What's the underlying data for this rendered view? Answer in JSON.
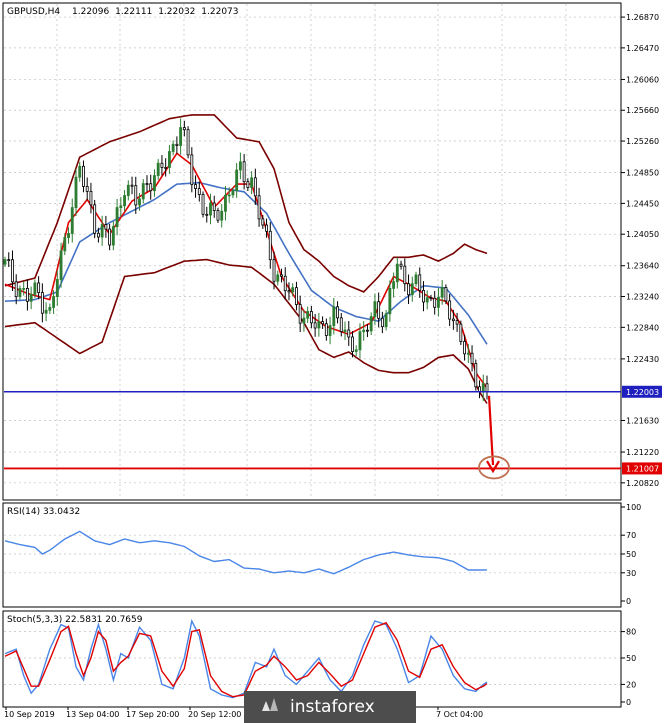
{
  "colors": {
    "background": "#ffffff",
    "grid": "#c0c0c0",
    "frame": "#000000",
    "bull_candle": "#2e7d32",
    "bear_candle": "#000000",
    "bollinger": "#7a0000",
    "ma_fast": "#e00000",
    "ma_slow": "#4472c4",
    "rsi_line": "#4a86e8",
    "stoch_main": "#4a86e8",
    "stoch_signal": "#e00000",
    "current_price_line": "#1f1fbf",
    "target_line": "#e00000",
    "target_label_bg": "#e00000",
    "current_label_bg": "#1f1fbf",
    "forecast_arrow": "#e00000",
    "watermark_bg": "#4d4d4d"
  },
  "chart_data": [
    {
      "type": "candlestick",
      "title": "GBPUSD,H4",
      "ohlc_header": [
        "1.22096",
        "1.22111",
        "1.22032",
        "1.22073"
      ],
      "ylim": [
        1.2061,
        1.2704
      ],
      "y_ticks": [
        "1.26870",
        "1.26470",
        "1.26060",
        "1.25660",
        "1.25260",
        "1.24850",
        "1.24450",
        "1.24050",
        "1.23640",
        "1.23240",
        "1.22840",
        "1.22430",
        "1.21630",
        "1.21220",
        "1.20820"
      ],
      "x_ticks": [
        "10 Sep 2019",
        "13 Sep 04:00",
        "17 Sep 20:00",
        "20 Sep 12:00",
        "7 Oct 04:00"
      ],
      "current_price": 1.22003,
      "current_price_label": "1.22003",
      "target_price": 1.21007,
      "target_price_label": "1.21007",
      "forecast": {
        "from": 1.2195,
        "to": 1.2118,
        "marker": "circle"
      },
      "close_anchors": [
        [
          0,
          1.2365
        ],
        [
          3,
          1.234
        ],
        [
          6,
          1.2322
        ],
        [
          9,
          1.233
        ],
        [
          12,
          1.23
        ],
        [
          15,
          1.2372
        ],
        [
          18,
          1.2448
        ],
        [
          20,
          1.2488
        ],
        [
          24,
          1.242
        ],
        [
          28,
          1.2395
        ],
        [
          32,
          1.247
        ],
        [
          35,
          1.2445
        ],
        [
          38,
          1.2475
        ],
        [
          41,
          1.248
        ],
        [
          44,
          1.251
        ],
        [
          47,
          1.2545
        ],
        [
          50,
          1.248
        ],
        [
          53,
          1.244
        ],
        [
          56,
          1.2425
        ],
        [
          60,
          1.246
        ],
        [
          63,
          1.2485
        ],
        [
          66,
          1.2475
        ],
        [
          69,
          1.241
        ],
        [
          72,
          1.236
        ],
        [
          76,
          1.2328
        ],
        [
          80,
          1.23
        ],
        [
          84,
          1.228
        ],
        [
          88,
          1.23
        ],
        [
          92,
          1.2265
        ],
        [
          96,
          1.227
        ],
        [
          99,
          1.231
        ],
        [
          102,
          1.2295
        ],
        [
          105,
          1.237
        ],
        [
          107,
          1.2345
        ],
        [
          110,
          1.2335
        ],
        [
          113,
          1.232
        ],
        [
          116,
          1.2325
        ],
        [
          119,
          1.2305
        ],
        [
          122,
          1.2275
        ],
        [
          124,
          1.2235
        ],
        [
          127,
          1.2208
        ],
        [
          129,
          1.2205
        ]
      ],
      "bollinger_upper": [
        [
          0,
          1.2338
        ],
        [
          8,
          1.2348
        ],
        [
          14,
          1.242
        ],
        [
          20,
          1.2505
        ],
        [
          28,
          1.2525
        ],
        [
          36,
          1.2538
        ],
        [
          44,
          1.2555
        ],
        [
          50,
          1.256
        ],
        [
          56,
          1.256
        ],
        [
          62,
          1.253
        ],
        [
          68,
          1.2525
        ],
        [
          72,
          1.249
        ],
        [
          76,
          1.242
        ],
        [
          80,
          1.2385
        ],
        [
          84,
          1.237
        ],
        [
          88,
          1.235
        ],
        [
          92,
          1.2338
        ],
        [
          96,
          1.233
        ],
        [
          100,
          1.235
        ],
        [
          104,
          1.2375
        ],
        [
          108,
          1.2375
        ],
        [
          112,
          1.2378
        ],
        [
          116,
          1.237
        ],
        [
          120,
          1.238
        ],
        [
          123,
          1.2392
        ],
        [
          126,
          1.2385
        ],
        [
          129,
          1.238
        ]
      ],
      "bollinger_lower": [
        [
          0,
          1.2285
        ],
        [
          8,
          1.229
        ],
        [
          14,
          1.227
        ],
        [
          20,
          1.225
        ],
        [
          26,
          1.2265
        ],
        [
          32,
          1.235
        ],
        [
          40,
          1.2355
        ],
        [
          48,
          1.237
        ],
        [
          54,
          1.2372
        ],
        [
          60,
          1.2365
        ],
        [
          66,
          1.2362
        ],
        [
          72,
          1.234
        ],
        [
          76,
          1.2315
        ],
        [
          80,
          1.229
        ],
        [
          84,
          1.2255
        ],
        [
          88,
          1.2245
        ],
        [
          92,
          1.2252
        ],
        [
          96,
          1.2238
        ],
        [
          100,
          1.2228
        ],
        [
          104,
          1.2225
        ],
        [
          108,
          1.2225
        ],
        [
          112,
          1.2232
        ],
        [
          116,
          1.2245
        ],
        [
          120,
          1.2248
        ],
        [
          124,
          1.223
        ],
        [
          127,
          1.22
        ],
        [
          129,
          1.2185
        ]
      ],
      "ma_fast": [
        [
          0,
          1.234
        ],
        [
          6,
          1.2328
        ],
        [
          12,
          1.232
        ],
        [
          17,
          1.242
        ],
        [
          22,
          1.245
        ],
        [
          28,
          1.2405
        ],
        [
          34,
          1.2448
        ],
        [
          40,
          1.2465
        ],
        [
          46,
          1.251
        ],
        [
          50,
          1.2495
        ],
        [
          56,
          1.244
        ],
        [
          62,
          1.247
        ],
        [
          66,
          1.247
        ],
        [
          70,
          1.241
        ],
        [
          74,
          1.235
        ],
        [
          80,
          1.2305
        ],
        [
          86,
          1.2285
        ],
        [
          92,
          1.2275
        ],
        [
          98,
          1.229
        ],
        [
          104,
          1.235
        ],
        [
          108,
          1.234
        ],
        [
          114,
          1.2322
        ],
        [
          118,
          1.2318
        ],
        [
          122,
          1.2288
        ],
        [
          126,
          1.2225
        ],
        [
          129,
          1.2205
        ]
      ],
      "ma_slow": [
        [
          0,
          1.2318
        ],
        [
          8,
          1.232
        ],
        [
          14,
          1.233
        ],
        [
          20,
          1.2395
        ],
        [
          28,
          1.242
        ],
        [
          34,
          1.2435
        ],
        [
          40,
          1.245
        ],
        [
          46,
          1.247
        ],
        [
          52,
          1.2472
        ],
        [
          58,
          1.2465
        ],
        [
          64,
          1.246
        ],
        [
          70,
          1.2432
        ],
        [
          76,
          1.238
        ],
        [
          82,
          1.2332
        ],
        [
          88,
          1.231
        ],
        [
          94,
          1.2298
        ],
        [
          100,
          1.2292
        ],
        [
          106,
          1.2318
        ],
        [
          112,
          1.2338
        ],
        [
          118,
          1.2335
        ],
        [
          124,
          1.23
        ],
        [
          129,
          1.2262
        ]
      ]
    },
    {
      "type": "line",
      "title": "RSI(14) 33.0432",
      "ylim": [
        0,
        100
      ],
      "y_ticks": [
        "100",
        "70",
        "50",
        "30",
        "0"
      ],
      "levels": [
        70,
        50,
        30
      ],
      "series": [
        {
          "values": [
            [
              0,
              64
            ],
            [
              4,
              60
            ],
            [
              8,
              57
            ],
            [
              10,
              50
            ],
            [
              12,
              54
            ],
            [
              16,
              66
            ],
            [
              20,
              74
            ],
            [
              24,
              64
            ],
            [
              28,
              60
            ],
            [
              32,
              66
            ],
            [
              36,
              62
            ],
            [
              40,
              64
            ],
            [
              44,
              62
            ],
            [
              48,
              58
            ],
            [
              52,
              48
            ],
            [
              56,
              42
            ],
            [
              60,
              44
            ],
            [
              64,
              35
            ],
            [
              68,
              34
            ],
            [
              72,
              30
            ],
            [
              76,
              32
            ],
            [
              80,
              30
            ],
            [
              84,
              34
            ],
            [
              88,
              29
            ],
            [
              92,
              36
            ],
            [
              96,
              44
            ],
            [
              100,
              49
            ],
            [
              104,
              52
            ],
            [
              108,
              49
            ],
            [
              112,
              47
            ],
            [
              116,
              46
            ],
            [
              120,
              42
            ],
            [
              124,
              33
            ],
            [
              128,
              33
            ],
            [
              129,
              33.0432
            ]
          ]
        }
      ]
    },
    {
      "type": "line",
      "title": "Stoch(5,3,3) 22.5831 20.7659",
      "ylim": [
        0,
        100
      ],
      "y_ticks": [
        "80",
        "50",
        "20",
        "0"
      ],
      "levels": [
        80,
        50,
        20
      ],
      "series": [
        {
          "values": [
            [
              0,
              55
            ],
            [
              3,
              60
            ],
            [
              5,
              30
            ],
            [
              7,
              10
            ],
            [
              9,
              20
            ],
            [
              12,
              60
            ],
            [
              15,
              88
            ],
            [
              17,
              84
            ],
            [
              19,
              40
            ],
            [
              21,
              25
            ],
            [
              23,
              60
            ],
            [
              25,
              88
            ],
            [
              27,
              60
            ],
            [
              29,
              25
            ],
            [
              31,
              55
            ],
            [
              33,
              50
            ],
            [
              36,
              85
            ],
            [
              39,
              70
            ],
            [
              42,
              20
            ],
            [
              45,
              15
            ],
            [
              48,
              50
            ],
            [
              50,
              92
            ],
            [
              52,
              75
            ],
            [
              55,
              15
            ],
            [
              58,
              8
            ],
            [
              61,
              5
            ],
            [
              64,
              10
            ],
            [
              67,
              45
            ],
            [
              70,
              40
            ],
            [
              72,
              60
            ],
            [
              75,
              30
            ],
            [
              78,
              20
            ],
            [
              81,
              35
            ],
            [
              84,
              50
            ],
            [
              87,
              25
            ],
            [
              90,
              12
            ],
            [
              93,
              30
            ],
            [
              96,
              65
            ],
            [
              99,
              92
            ],
            [
              102,
              88
            ],
            [
              105,
              60
            ],
            [
              108,
              22
            ],
            [
              111,
              30
            ],
            [
              114,
              75
            ],
            [
              117,
              60
            ],
            [
              120,
              30
            ],
            [
              123,
              15
            ],
            [
              126,
              12
            ],
            [
              128,
              20
            ],
            [
              129,
              22.5831
            ]
          ]
        },
        {
          "values": [
            [
              0,
              52
            ],
            [
              3,
              58
            ],
            [
              5,
              38
            ],
            [
              7,
              18
            ],
            [
              9,
              18
            ],
            [
              12,
              48
            ],
            [
              15,
              80
            ],
            [
              17,
              86
            ],
            [
              19,
              55
            ],
            [
              21,
              30
            ],
            [
              23,
              50
            ],
            [
              25,
              80
            ],
            [
              27,
              70
            ],
            [
              29,
              35
            ],
            [
              31,
              45
            ],
            [
              33,
              52
            ],
            [
              36,
              78
            ],
            [
              39,
              75
            ],
            [
              42,
              35
            ],
            [
              45,
              18
            ],
            [
              48,
              38
            ],
            [
              50,
              80
            ],
            [
              52,
              82
            ],
            [
              55,
              30
            ],
            [
              58,
              12
            ],
            [
              61,
              6
            ],
            [
              64,
              8
            ],
            [
              67,
              35
            ],
            [
              70,
              42
            ],
            [
              72,
              52
            ],
            [
              75,
              40
            ],
            [
              78,
              25
            ],
            [
              81,
              30
            ],
            [
              84,
              45
            ],
            [
              87,
              32
            ],
            [
              90,
              18
            ],
            [
              93,
              25
            ],
            [
              96,
              55
            ],
            [
              99,
              85
            ],
            [
              102,
              90
            ],
            [
              105,
              70
            ],
            [
              108,
              35
            ],
            [
              111,
              28
            ],
            [
              114,
              60
            ],
            [
              117,
              65
            ],
            [
              120,
              40
            ],
            [
              123,
              22
            ],
            [
              126,
              14
            ],
            [
              128,
              18
            ],
            [
              129,
              20.7659
            ]
          ]
        }
      ]
    }
  ],
  "watermark": {
    "text": "instaforex"
  }
}
